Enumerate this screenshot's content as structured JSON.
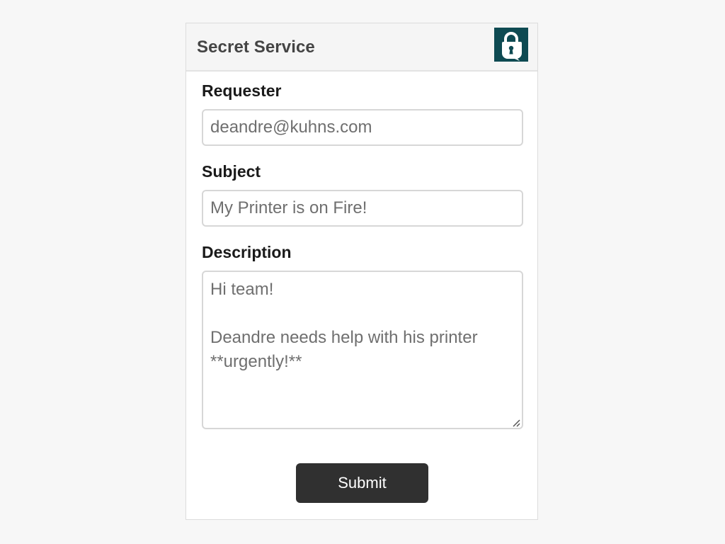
{
  "header": {
    "title": "Secret Service",
    "logo_icon": "lock-chat-icon",
    "logo_color": "#0e4a52"
  },
  "form": {
    "requester": {
      "label": "Requester",
      "value": "deandre@kuhns.com"
    },
    "subject": {
      "label": "Subject",
      "value": "My Printer is on Fire!"
    },
    "description": {
      "label": "Description",
      "value": "Hi team!\n\nDeandre needs help with his printer **urgently!**"
    },
    "submit_label": "Submit"
  },
  "colors": {
    "page_background": "#f7f7f7",
    "header_background": "#f5f5f5",
    "button_background": "#303030",
    "input_text": "#6f6f6f"
  }
}
